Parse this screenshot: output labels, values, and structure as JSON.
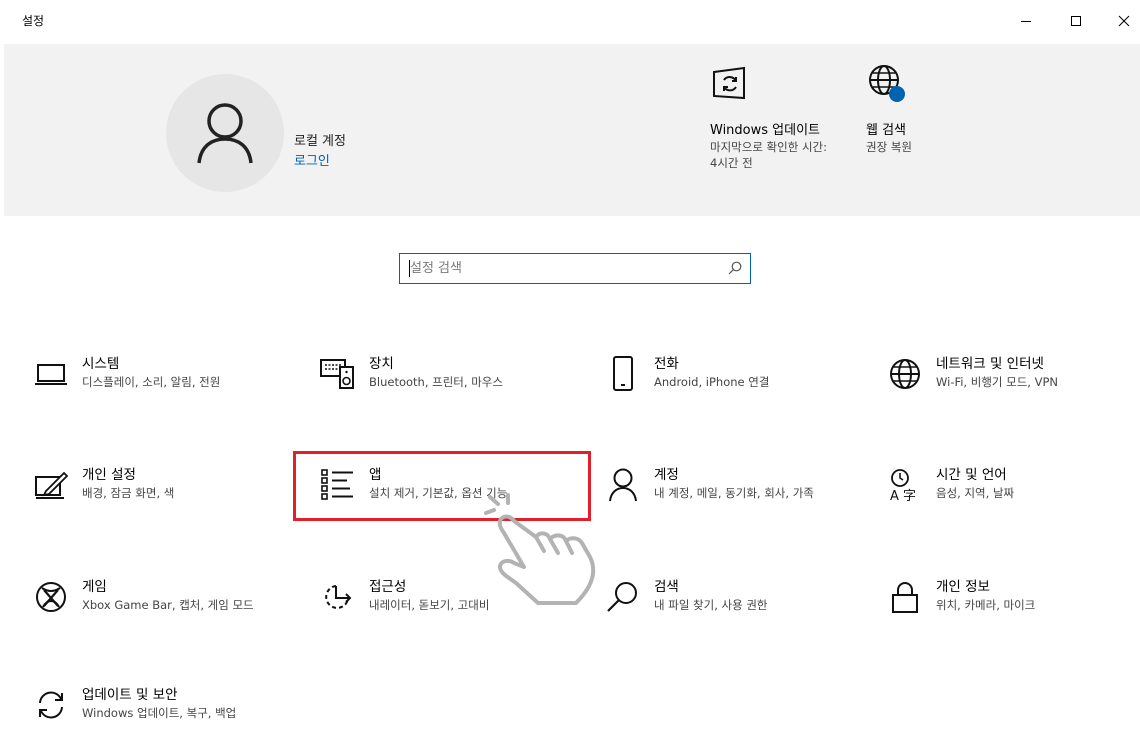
{
  "window": {
    "title": "설정"
  },
  "account": {
    "name": "로컬 계정",
    "login_link": "로그인"
  },
  "header_items": [
    {
      "title": "Windows 업데이트",
      "subtitle": "마지막으로 확인한 시간: 4시간 전"
    },
    {
      "title": "웹 검색",
      "subtitle": "권장 복원"
    }
  ],
  "search": {
    "placeholder": "설정 검색"
  },
  "tiles": [
    {
      "title": "시스템",
      "desc": "디스플레이, 소리, 알림, 전원"
    },
    {
      "title": "장치",
      "desc": "Bluetooth, 프린터, 마우스"
    },
    {
      "title": "전화",
      "desc": "Android, iPhone 연결"
    },
    {
      "title": "네트워크 및 인터넷",
      "desc": "Wi-Fi, 비행기 모드, VPN"
    },
    {
      "title": "개인 설정",
      "desc": "배경, 잠금 화면, 색"
    },
    {
      "title": "앱",
      "desc": "설치 제거, 기본값, 옵션 기능"
    },
    {
      "title": "계정",
      "desc": "내 계정, 메일, 동기화, 회사, 가족"
    },
    {
      "title": "시간 및 언어",
      "desc": "음성, 지역, 날짜"
    },
    {
      "title": "게임",
      "desc": "Xbox Game Bar, 캡처, 게임 모드"
    },
    {
      "title": "접근성",
      "desc": "내레이터, 돋보기, 고대비"
    },
    {
      "title": "검색",
      "desc": "내 파일 찾기, 사용 권한"
    },
    {
      "title": "개인 정보",
      "desc": "위치, 카메라, 마이크"
    },
    {
      "title": "업데이트 및 보안",
      "desc": "Windows 업데이트, 복구, 백업"
    }
  ],
  "colors": {
    "accent": "#0063b1",
    "highlight": "#e0202a",
    "header_bg": "#f2f2f2"
  }
}
